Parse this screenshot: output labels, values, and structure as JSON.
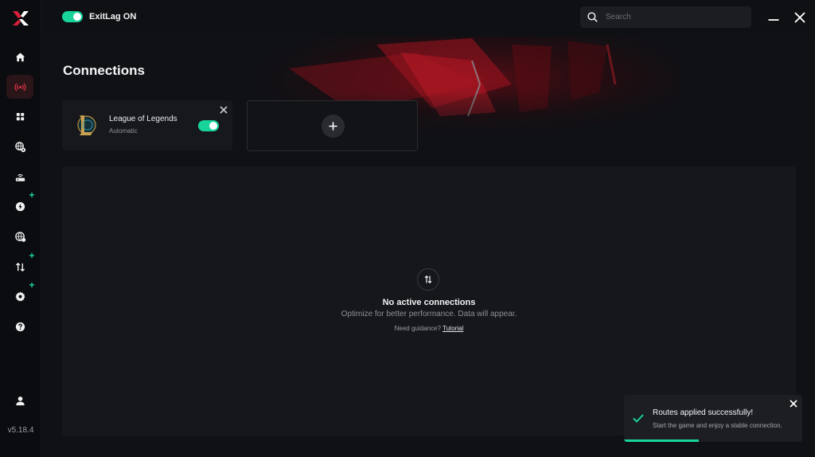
{
  "app": {
    "toggle_label": "ExitLag ON",
    "toggle_on": true,
    "version": "v5.18.4",
    "accent_color": "#18d39a",
    "brand_color": "#d8203a"
  },
  "search": {
    "placeholder": "Search",
    "value": ""
  },
  "sidebar": {
    "items": [
      {
        "icon": "home-icon",
        "active": false,
        "badge": false
      },
      {
        "icon": "connections-icon",
        "active": true,
        "badge": false
      },
      {
        "icon": "apps-grid-icon",
        "active": false,
        "badge": false
      },
      {
        "icon": "globe-gear-icon",
        "active": false,
        "badge": false
      },
      {
        "icon": "router-icon",
        "active": false,
        "badge": false
      },
      {
        "icon": "lightning-icon",
        "active": false,
        "badge": true
      },
      {
        "icon": "globe-icon",
        "active": false,
        "badge": false
      },
      {
        "icon": "transfer-icon",
        "active": false,
        "badge": true
      },
      {
        "icon": "settings-icon",
        "active": false,
        "badge": true
      },
      {
        "icon": "help-icon",
        "active": false,
        "badge": false
      },
      {
        "icon": "user-icon",
        "active": false,
        "badge": false
      }
    ]
  },
  "main": {
    "title": "Connections",
    "game_card": {
      "name": "League of Legends",
      "mode": "Automatic",
      "enabled": true
    },
    "empty_state": {
      "title": "No active connections",
      "subtitle": "Optimize for better performance. Data will appear.",
      "guidance_prefix": "Need guidance?",
      "guidance_link": "Tutorial"
    }
  },
  "toast": {
    "title": "Routes applied successfully!",
    "message": "Start the game and enjoy a stable connection.",
    "progress": 0.42
  }
}
